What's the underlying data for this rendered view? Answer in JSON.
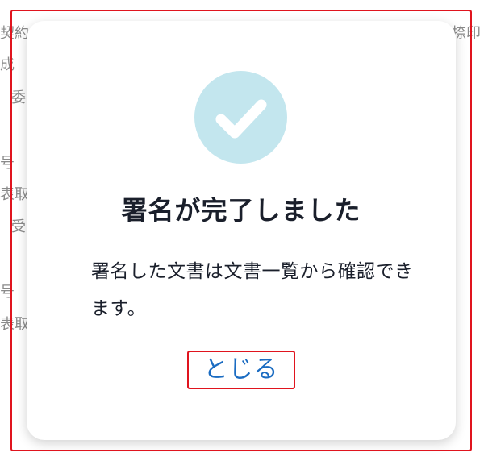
{
  "background_document": {
    "fragments": [
      "契約",
      "捺印",
      "成",
      "委",
      "号",
      "表取",
      "受",
      "号",
      "表取"
    ]
  },
  "modal": {
    "icon": "check-circle-icon",
    "icon_bg_color": "#c3e6ee",
    "title": "署名が完了しました",
    "message": "署名した文書は文書一覧から確認できます。",
    "close_button_label": "とじる",
    "close_button_color": "#1b6cc2",
    "highlight_color": "#e0141e"
  }
}
